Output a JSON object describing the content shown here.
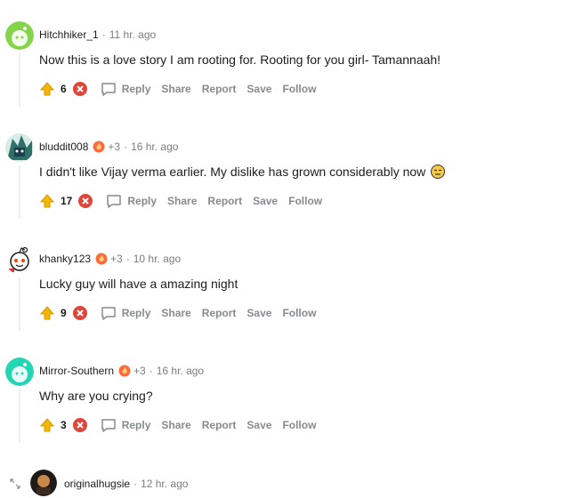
{
  "comments": [
    {
      "author": "Hitchhiker_1",
      "flair": "",
      "time": "11 hr. ago",
      "body": "Now this is a love story I am rooting for. Rooting for you girl- Tamannaah!",
      "score": "6",
      "avatar": "green-snoo"
    },
    {
      "author": "bluddit008",
      "flair": "+3",
      "time": "16 hr. ago",
      "body": "I didn't like Vijay verma earlier. My dislike has grown considerably now",
      "score": "17",
      "avatar": "custom-teal-art"
    },
    {
      "author": "khanky123",
      "flair": "+3",
      "time": "10 hr. ago",
      "body": "Lucky guy will have a amazing night",
      "score": "9",
      "avatar": "snoo-white"
    },
    {
      "author": "Mirror-Southern",
      "flair": "+3",
      "time": "16 hr. ago",
      "body": "Why are you crying?",
      "score": "3",
      "avatar": "teal-snoo"
    }
  ],
  "last_comment": {
    "author": "originalhugsie",
    "time": "12 hr. ago",
    "avatar": "dark-avatar"
  },
  "actions": {
    "reply": "Reply",
    "share": "Share",
    "report": "Report",
    "save": "Save",
    "follow": "Follow"
  },
  "separator": "·",
  "colors": {
    "meta_gray": "#7c7c7c",
    "action_gray": "#878a8c",
    "upvote_gold": "#f2b705",
    "downvote_red": "#e0453a"
  }
}
